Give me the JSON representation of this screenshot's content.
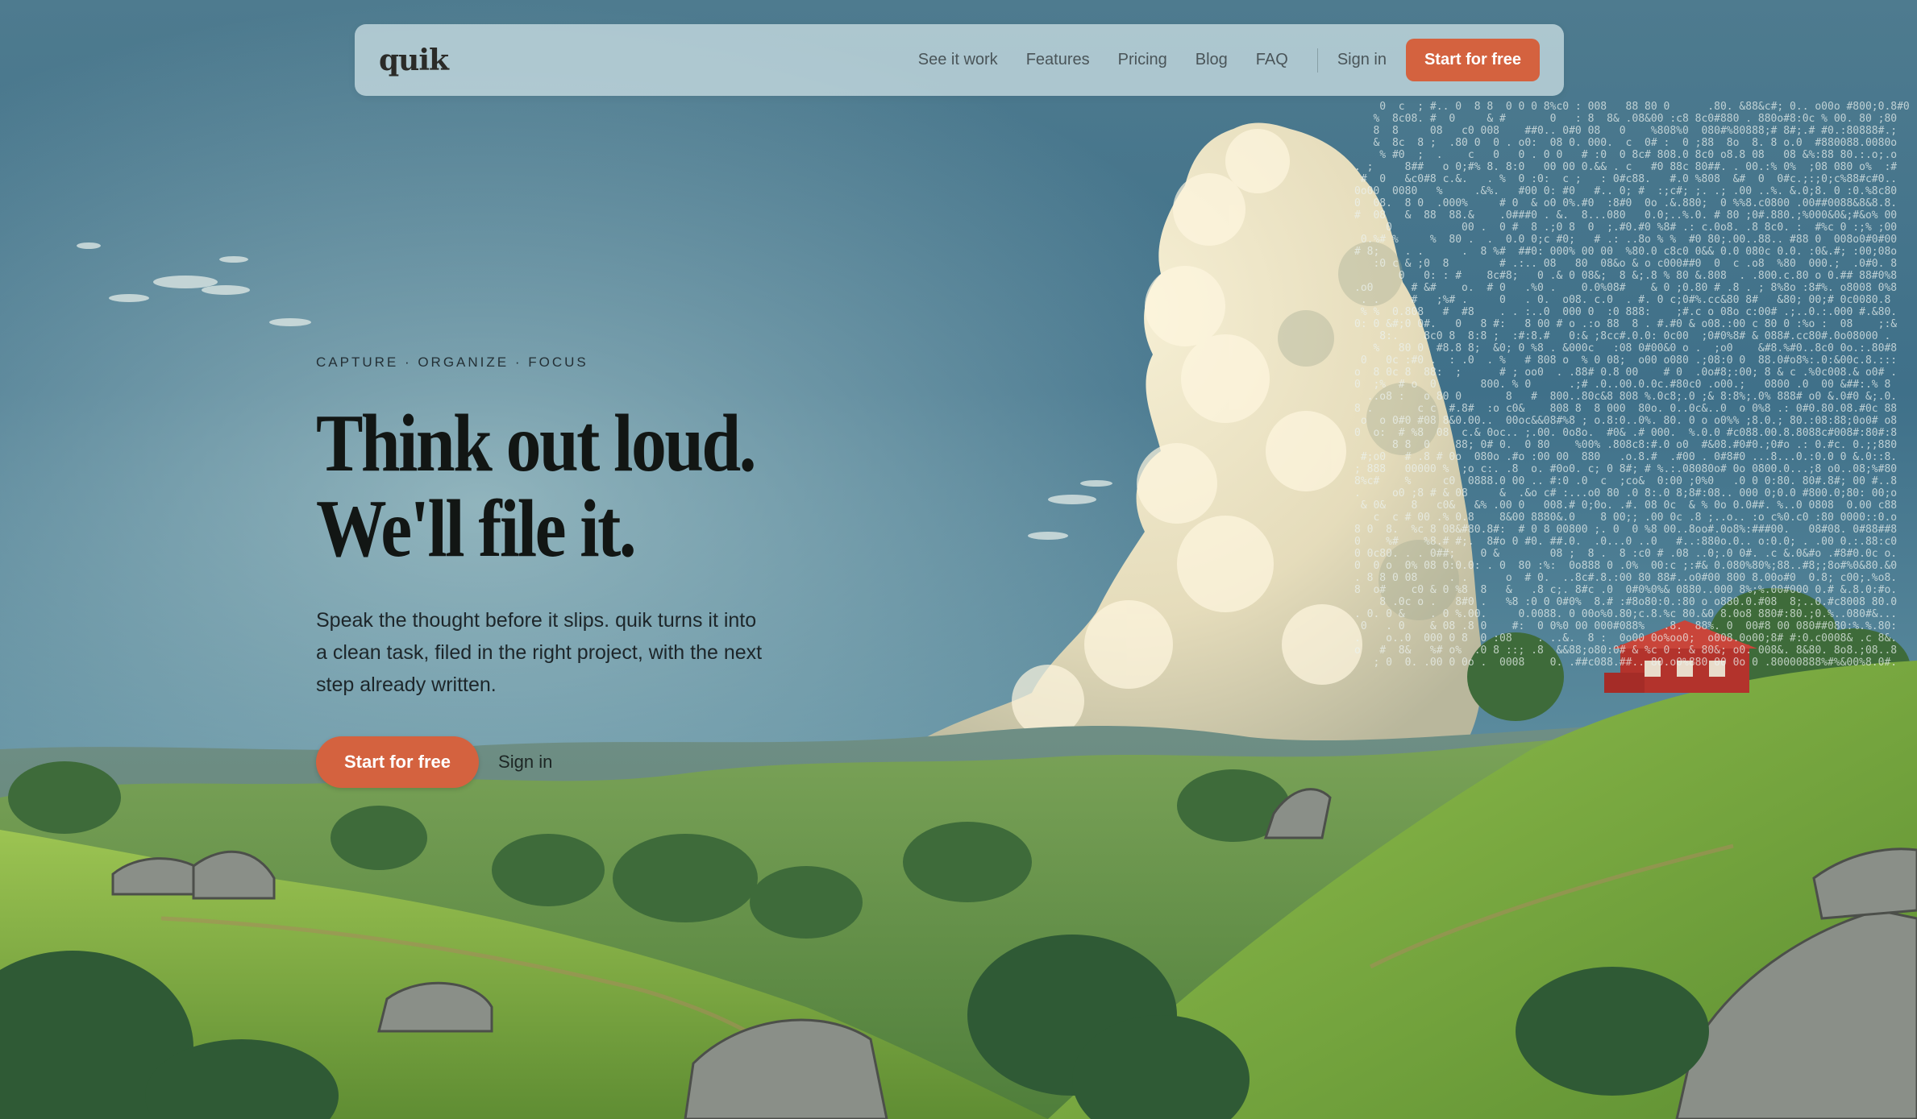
{
  "nav": {
    "logo": "quik",
    "links": [
      "See it work",
      "Features",
      "Pricing",
      "Blog",
      "FAQ"
    ],
    "signin": "Sign in",
    "cta": "Start for free"
  },
  "hero": {
    "eyebrow": "CAPTURE · ORGANIZE · FOCUS",
    "headline_line1": "Think out loud.",
    "headline_line2": "We'll file it.",
    "subcopy": "Speak the thought before it slips. quik turns it into a clean task, filed in the right project, with the next step already written.",
    "cta": "Start for free",
    "signin": "Sign in"
  },
  "colors": {
    "accent": "#d4623f",
    "sky": "#3f6f87",
    "grass": "#7aa53f"
  },
  "icons": {
    "logo": "quik-wordmark"
  }
}
